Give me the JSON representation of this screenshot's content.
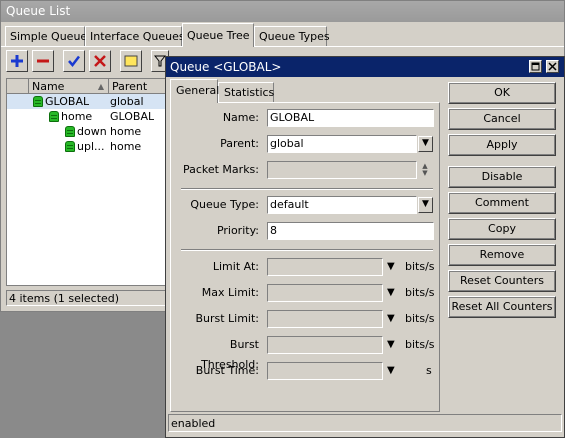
{
  "queue_list": {
    "title": "Queue List",
    "tabs": [
      "Simple Queues",
      "Interface Queues",
      "Queue Tree",
      "Queue Types"
    ],
    "active_tab": "Queue Tree",
    "columns": [
      "Name",
      "Parent"
    ],
    "rows": [
      {
        "name": "GLOBAL",
        "parent": "global",
        "level": 0,
        "selected": true
      },
      {
        "name": "home",
        "parent": "GLOBAL",
        "level": 1,
        "selected": false
      },
      {
        "name": "down",
        "parent": "home",
        "level": 2,
        "selected": false
      },
      {
        "name": "upl...",
        "parent": "home",
        "level": 2,
        "selected": false
      }
    ],
    "status": "4 items (1 selected)"
  },
  "dialog": {
    "title": "Queue <GLOBAL>",
    "tabs": [
      "General",
      "Statistics"
    ],
    "active_tab": "General",
    "fields": {
      "name_label": "Name:",
      "name_value": "GLOBAL",
      "parent_label": "Parent:",
      "parent_value": "global",
      "packet_marks_label": "Packet Marks:",
      "packet_marks_value": "",
      "queue_type_label": "Queue Type:",
      "queue_type_value": "default",
      "priority_label": "Priority:",
      "priority_value": "8",
      "limit_at_label": "Limit At:",
      "limit_at_value": "",
      "max_limit_label": "Max Limit:",
      "max_limit_value": "",
      "burst_limit_label": "Burst Limit:",
      "burst_limit_value": "",
      "burst_threshold_label": "Burst Threshold:",
      "burst_threshold_value": "",
      "burst_time_label": "Burst Time:",
      "burst_time_value": ""
    },
    "units": {
      "bits": "bits/s",
      "seconds": "s"
    },
    "buttons": {
      "ok": "OK",
      "cancel": "Cancel",
      "apply": "Apply",
      "disable": "Disable",
      "comment": "Comment",
      "copy": "Copy",
      "remove": "Remove",
      "reset_counters": "Reset Counters",
      "reset_all_counters": "Reset All Counters"
    },
    "status": "enabled"
  },
  "colors": {
    "title_active": "#0a246a",
    "selection": "#d6e4f4",
    "queue_icon": "#27b827"
  }
}
